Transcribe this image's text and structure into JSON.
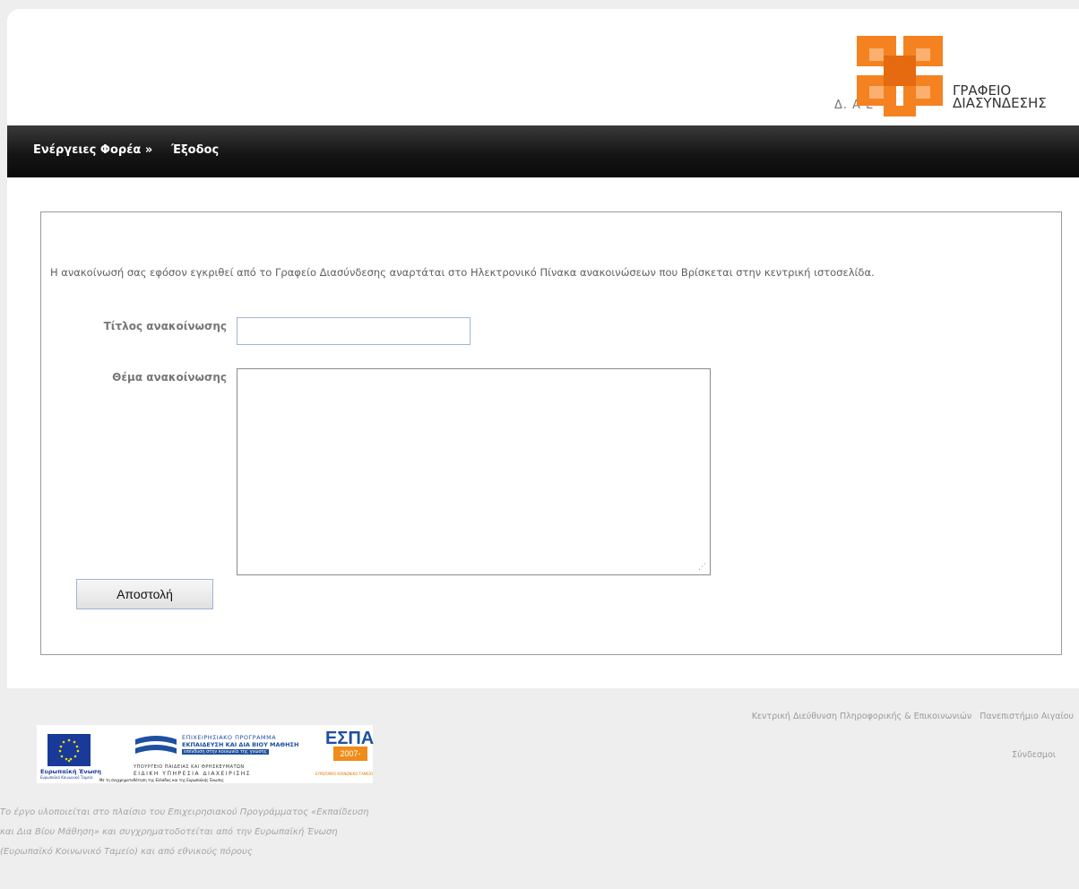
{
  "header": {
    "logo_line1": "ΓΡΑΦΕΙΟ",
    "logo_line2": "ΔΙΑΣΥΝΔΕΣΗΣ",
    "logo_partial": "Δ.       Α        Ε",
    "colors": {
      "logo_orange": "#f58220",
      "logo_dark_orange": "#e56a10"
    }
  },
  "nav": {
    "actions_label": "Ενέργειες Φορέα »",
    "exit_label": "Έξοδος"
  },
  "form": {
    "notice": "Η ανακοίνωσή σας εφόσον εγκριθεί από το Γραφείο Διασύνδεσης αναρτάται στο Ηλεκτρονικό Πίνακα ανακοινώσεων που Βρίσκεται στην κεντρική ιστοσελίδα.",
    "title_label": "Τίτλος ανακοίνωσης",
    "title_value": "",
    "subject_label": "Θέμα ανακοίνωσης",
    "subject_value": "",
    "submit_label": "Αποστολή"
  },
  "footer": {
    "link1": "Κεντρική Διεύθυνση Πληροφορικής & Επικοινωνιών",
    "link2": "Πανεπιστήμιο Αιγαίου",
    "sitemap": "Σύνδεσμοι",
    "banner": {
      "eu_label": "Ευρωπαϊκή Ένωση",
      "eu_sub": "Ευρωπαϊκό Κοινωνικό Ταμείο",
      "program_line1": "ΕΠΙΧΕΙΡΗΣΙΑΚΟ ΠΡΟΓΡΑΜΜΑ",
      "program_line2": "ΕΚΠΑΙΔΕΥΣΗ ΚΑΙ ΔΙΑ ΒΙΟΥ ΜΑΘΗΣΗ",
      "program_line3": "επένδυση στην κοινωνία της γνώσης",
      "ministry_line1": "ΥΠΟΥΡΓΕΙΟ ΠΑΙΔΕΙΑΣ ΚΑΙ ΘΡΗΣΚΕΥΜΑΤΩΝ",
      "ministry_line2": "ΕΙΔΙΚΗ ΥΠΗΡΕΣΙΑ ΔΙΑΧΕΙΡΙΣΗΣ",
      "cofund": "Με τη συγχρηματοδότηση της Ελλάδας και της Ευρωπαϊκής Ένωσης",
      "espa_title": "ΕΣΠΑ",
      "espa_years": "2007-2013",
      "espa_fund": "ΕΥΡΩΠΑΪΚΟ ΚΟΙΝΩΝΙΚΟ ΤΑΜΕΙΟ"
    },
    "text_line1": "Το έργο υλοποιείται στο πλαίσιο του Επιχειρησιακού Προγράμματος «Εκπαίδευση",
    "text_line2": "και Δια Βίου Μάθηση» και συγχρηματοδοτείται από την Ευρωπαϊκή Ένωση",
    "text_line3": "(Ευρωπαϊκό Κοινωνικό Ταμείο) και από εθνικούς πόρους"
  }
}
